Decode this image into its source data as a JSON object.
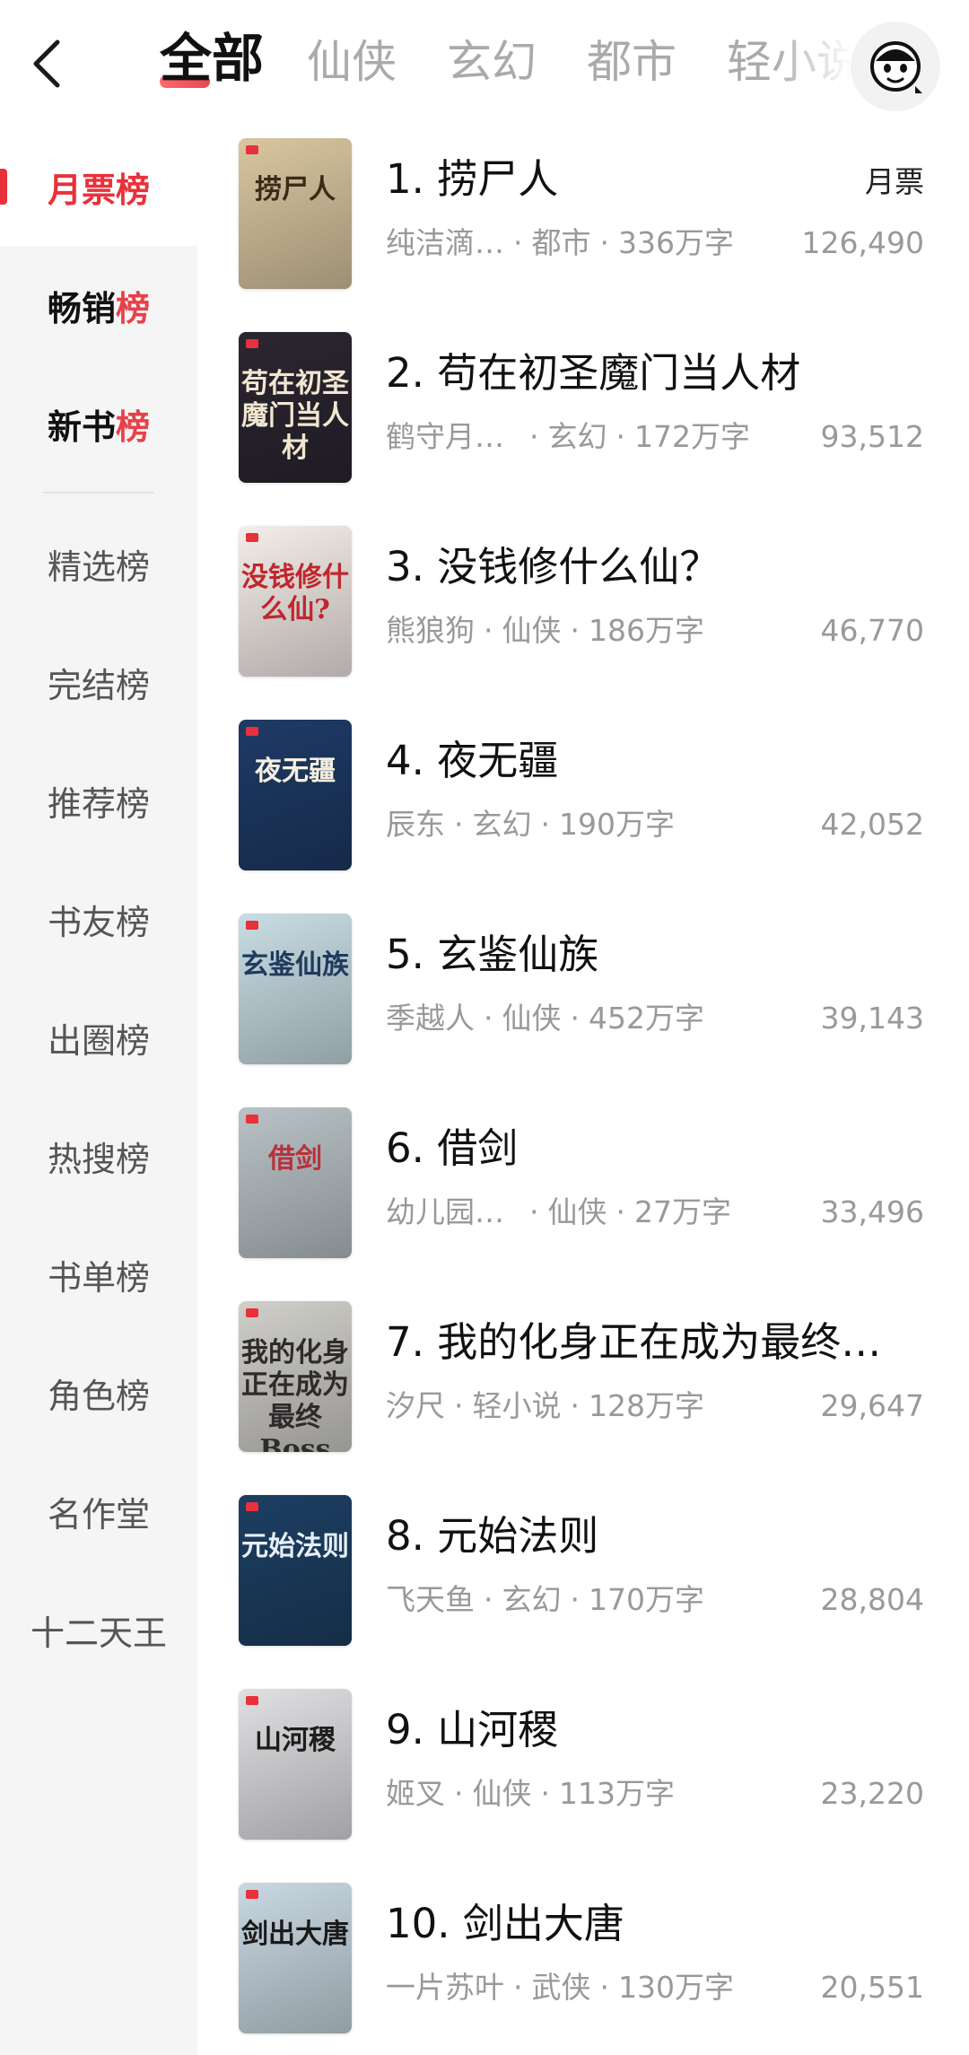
{
  "header": {
    "tabs": [
      "全部",
      "仙侠",
      "玄幻",
      "都市",
      "轻小说"
    ],
    "active_tab": "全部"
  },
  "sidebar": {
    "items": [
      {
        "label": "月票",
        "suffix": "榜"
      },
      {
        "label": "畅销",
        "suffix": "榜"
      },
      {
        "label": "新书",
        "suffix": "榜"
      },
      {
        "label": "精选榜",
        "suffix": ""
      },
      {
        "label": "完结榜",
        "suffix": ""
      },
      {
        "label": "推荐榜",
        "suffix": ""
      },
      {
        "label": "书友榜",
        "suffix": ""
      },
      {
        "label": "出圈榜",
        "suffix": ""
      },
      {
        "label": "热搜榜",
        "suffix": ""
      },
      {
        "label": "书单榜",
        "suffix": ""
      },
      {
        "label": "角色榜",
        "suffix": ""
      },
      {
        "label": "名作堂",
        "suffix": ""
      },
      {
        "label": "十二天王",
        "suffix": ""
      }
    ]
  },
  "list": {
    "column_label": "月票",
    "books": [
      {
        "title": "1. 捞尸人",
        "author": "纯洁滴…",
        "genre": "都市",
        "words": "336万字",
        "count": "126,490",
        "cover_text": "捞尸人",
        "cover_bg": "#d9c6a0",
        "cover_fg": "#3a2a18"
      },
      {
        "title": "2. 苟在初圣魔门当人材",
        "author": "鹤守月满池",
        "genre": "玄幻",
        "words": "172万字",
        "count": "93,512",
        "cover_text": "苟在初圣魔门当人材",
        "cover_bg": "#2b2630",
        "cover_fg": "#f1e6d0"
      },
      {
        "title": "3. 没钱修什么仙？",
        "author": "熊狼狗",
        "genre": "仙侠",
        "words": "186万字",
        "count": "46,770",
        "cover_text": "没钱修什么仙?",
        "cover_bg": "#f4eeea",
        "cover_fg": "#c0272d"
      },
      {
        "title": "4. 夜无疆",
        "author": "辰东",
        "genre": "玄幻",
        "words": "190万字",
        "count": "42,052",
        "cover_text": "夜无疆",
        "cover_bg": "#1e3a66",
        "cover_fg": "#f5f0e0"
      },
      {
        "title": "5. 玄鉴仙族",
        "author": "季越人",
        "genre": "仙侠",
        "words": "452万字",
        "count": "39,143",
        "cover_text": "玄鉴仙族",
        "cover_bg": "#c8dde4",
        "cover_fg": "#1f3b5c"
      },
      {
        "title": "6. 借剑",
        "author": "幼儿园一…",
        "genre": "仙侠",
        "words": "27万字",
        "count": "33,496",
        "cover_text": "借剑",
        "cover_bg": "#b9c2c6",
        "cover_fg": "#b8323a"
      },
      {
        "title": "7. 我的化身正在成为最终…",
        "author": "汐尺",
        "genre": "轻小说",
        "words": "128万字",
        "count": "29,647",
        "cover_text": "我的化身正在成为最终Boss",
        "cover_bg": "#d0cfca",
        "cover_fg": "#2d2b2b"
      },
      {
        "title": "8. 元始法则",
        "author": "飞天鱼",
        "genre": "玄幻",
        "words": "170万字",
        "count": "28,804",
        "cover_text": "元始法则",
        "cover_bg": "#1d3f63",
        "cover_fg": "#e6eef6"
      },
      {
        "title": "9. 山河稷",
        "author": "姬叉",
        "genre": "仙侠",
        "words": "113万字",
        "count": "23,220",
        "cover_text": "山河稷",
        "cover_bg": "#dfe0e2",
        "cover_fg": "#1d1d1d"
      },
      {
        "title": "10. 剑出大唐",
        "author": "一片苏叶",
        "genre": "武侠",
        "words": "130万字",
        "count": "20,551",
        "cover_text": "剑出大唐",
        "cover_bg": "#c9d8e3",
        "cover_fg": "#1a1a1a"
      }
    ]
  },
  "colors": {
    "accent": "#e8313a",
    "sidebar_bg": "#f5f5f5",
    "muted_text": "#999999"
  },
  "icons": {
    "back": "chevron-left-icon",
    "avatar": "monkey-avatar-icon"
  }
}
